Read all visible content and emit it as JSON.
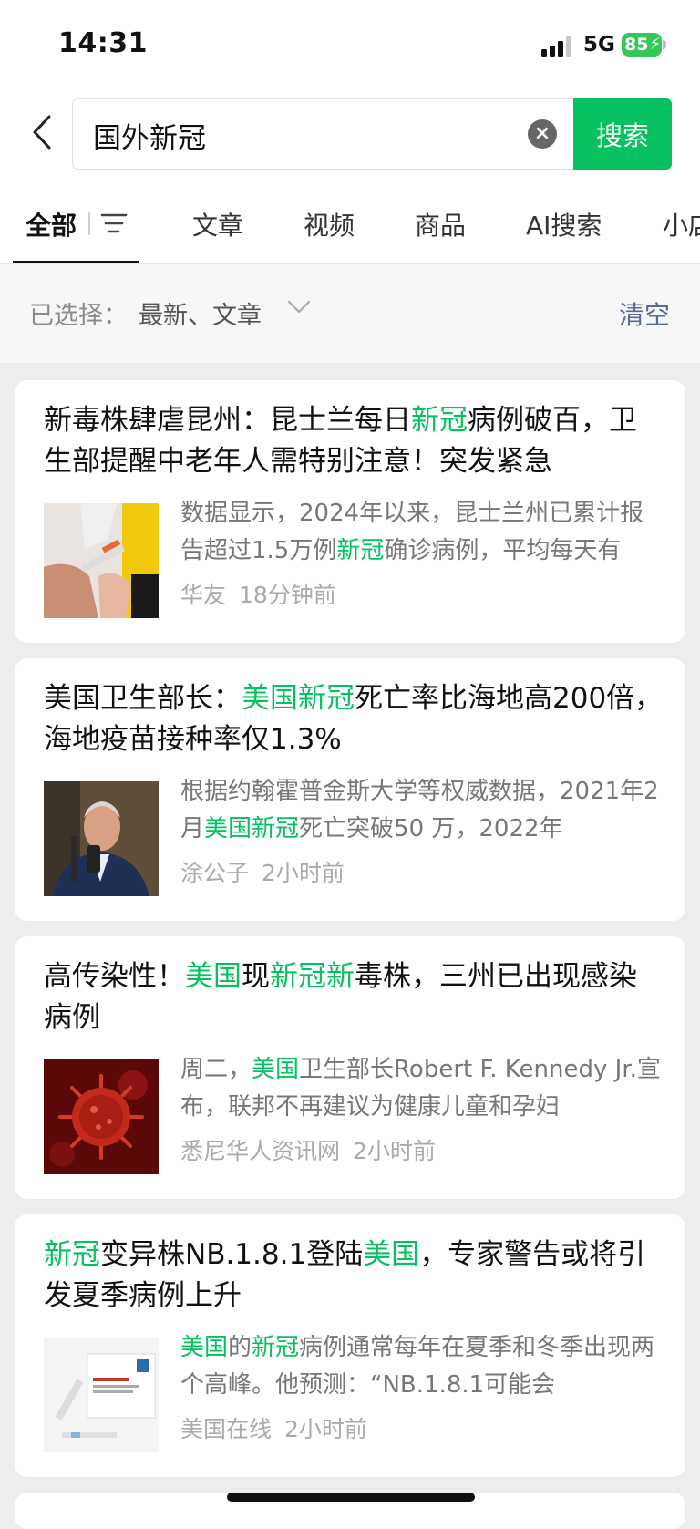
{
  "status_bar": {
    "time": "14:31",
    "network": "5G",
    "battery": "85"
  },
  "search": {
    "query": "国外新冠",
    "button_label": "搜索"
  },
  "tabs": [
    {
      "label": "全部"
    },
    {
      "label": "文章"
    },
    {
      "label": "视频"
    },
    {
      "label": "商品"
    },
    {
      "label": "AI搜索"
    },
    {
      "label": "小店"
    }
  ],
  "filter": {
    "label": "已选择：",
    "value": "最新、文章",
    "clear_label": "清空"
  },
  "results": [
    {
      "title": [
        {
          "t": "新毒株肆虐昆州：昆士兰每日"
        },
        {
          "t": "新冠",
          "hl": true
        },
        {
          "t": "病例破百，卫生部提醒中老年人需特别注意！突发紧急"
        }
      ],
      "snippet": [
        {
          "t": "数据显示，2024年以来，昆士兰州已累计报告超过1.5万例"
        },
        {
          "t": "新冠",
          "hl": true
        },
        {
          "t": "确诊病例，平均每天有"
        }
      ],
      "source": "华友",
      "time": "18分钟前"
    },
    {
      "title": [
        {
          "t": "美国卫生部长："
        },
        {
          "t": "美国新冠",
          "hl": true
        },
        {
          "t": "死亡率比海地高200倍，海地疫苗接种率仅1.3%"
        }
      ],
      "snippet": [
        {
          "t": "根据约翰霍普金斯大学等权威数据，2021年2月"
        },
        {
          "t": "美国新冠",
          "hl": true
        },
        {
          "t": "死亡突破50 万，2022年"
        }
      ],
      "source": "涂公子",
      "time": "2小时前"
    },
    {
      "title": [
        {
          "t": "高传染性！"
        },
        {
          "t": "美国",
          "hl": true
        },
        {
          "t": "现"
        },
        {
          "t": "新冠新",
          "hl": true
        },
        {
          "t": "毒株，三州已出现感染病例"
        }
      ],
      "snippet": [
        {
          "t": "周二，"
        },
        {
          "t": "美国",
          "hl": true
        },
        {
          "t": "卫生部长Robert F. Kennedy Jr.宣布，联邦不再建议为健康儿童和孕妇"
        }
      ],
      "source": "悉尼华人资讯网",
      "time": "2小时前"
    },
    {
      "title": [
        {
          "t": "新冠",
          "hl": true
        },
        {
          "t": "变异株NB.1.8.1登陆"
        },
        {
          "t": "美国",
          "hl": true
        },
        {
          "t": "，专家警告或将引发夏季病例上升"
        }
      ],
      "snippet": [
        {
          "t": "美国",
          "hl": true
        },
        {
          "t": "的"
        },
        {
          "t": "新冠",
          "hl": true
        },
        {
          "t": "病例通常每年在夏季和冬季出现两个高峰。他预测：“NB.1.8.1可能会"
        }
      ],
      "source": "美国在线",
      "time": "2小时前"
    }
  ]
}
